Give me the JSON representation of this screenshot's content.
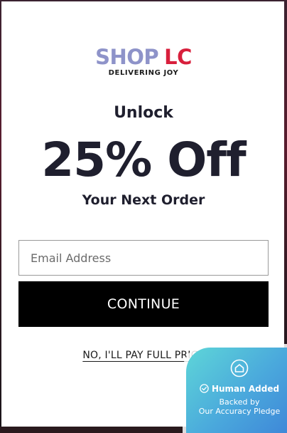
{
  "brand": {
    "logo_shop": "SHOP",
    "logo_lc": "LC",
    "tagline": "DELIVERING JOY"
  },
  "offer": {
    "unlock": "Unlock",
    "discount": "25% Off",
    "next_order": "Your Next Order"
  },
  "form": {
    "email_placeholder": "Email Address",
    "email_value": "",
    "continue_label": "CONTINUE",
    "decline_label": "NO, I'LL PAY FULL PRICE"
  },
  "badge": {
    "icon": "home-shield-icon",
    "title": "Human Added",
    "line1": "Backed by",
    "line2": "Our Accuracy Pledge"
  },
  "colors": {
    "brand_purple": "#8e93c9",
    "brand_red": "#d81f3c",
    "button_black": "#000000",
    "badge_teal": "#5ed6d8",
    "badge_blue": "#3e86d8"
  }
}
